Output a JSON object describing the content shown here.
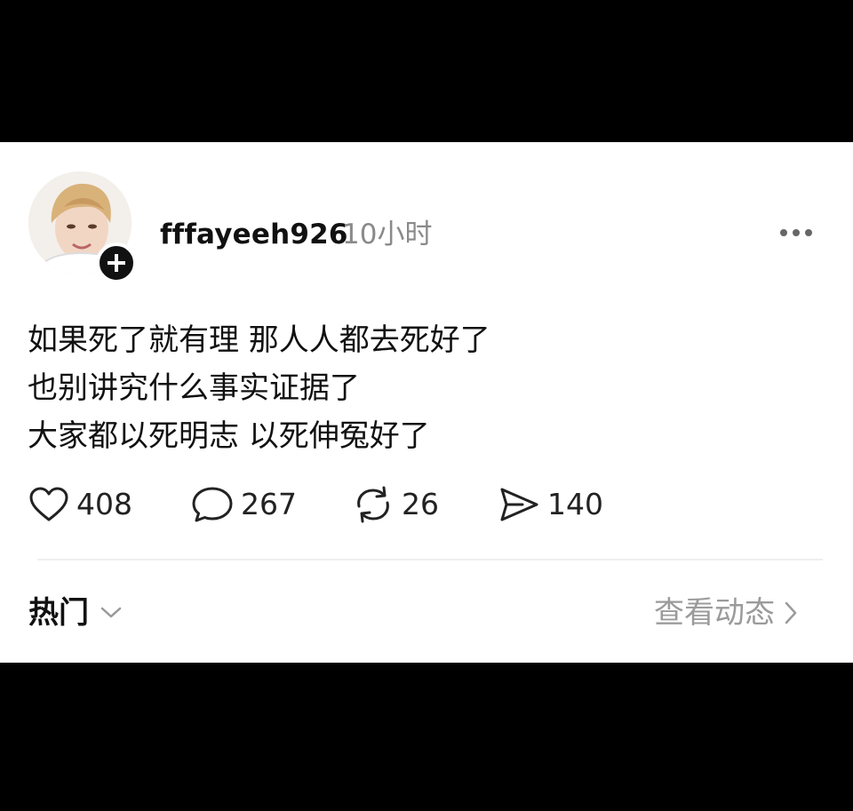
{
  "post": {
    "username": "fffayeeh926",
    "time": "10小时",
    "lines": [
      "如果死了就有理 那人人都去死好了",
      "也别讲究什么事实证据了",
      "大家都以死明志 以死伸冤好了"
    ]
  },
  "actions": {
    "like_count": "408",
    "comment_count": "267",
    "repost_count": "26",
    "share_count": "140"
  },
  "footer": {
    "hot_label": "热门",
    "view_feed_label": "查看动态"
  },
  "icons": {
    "avatar": "avatar",
    "follow": "plus-icon",
    "more": "more-icon",
    "like": "heart-icon",
    "comment": "comment-icon",
    "repost": "repost-icon",
    "share": "share-icon",
    "dropdown": "chevron-down-icon",
    "forward": "chevron-right-icon"
  },
  "colors": {
    "background": "#000000",
    "card": "#ffffff",
    "text": "#111111",
    "muted": "#8a8a8a"
  }
}
